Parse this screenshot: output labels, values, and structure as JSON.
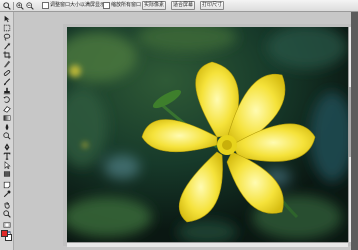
{
  "options_bar": {
    "resize_window_checkbox": {
      "label": "调整窗口大小以满屏显示",
      "checked": false
    },
    "zoom_all_windows_checkbox": {
      "label": "缩放所有窗口",
      "checked": false
    },
    "buttons": [
      "实际像素",
      "适合屏幕",
      "打印尺寸"
    ]
  },
  "toolbox": {
    "tools": [
      "move-icon",
      "marquee-icon",
      "lasso-icon",
      "magic-wand-icon",
      "crop-icon",
      "slice-icon",
      "healing-brush-icon",
      "brush-icon",
      "clone-stamp-icon",
      "history-brush-icon",
      "eraser-icon",
      "gradient-icon",
      "blur-icon",
      "dodge-icon",
      "pen-icon",
      "type-icon",
      "path-select-icon",
      "shape-icon",
      "notes-icon",
      "eyedropper-icon",
      "hand-icon",
      "zoom-icon"
    ],
    "foreground_color": "#e02828",
    "background_color": "#ffffff"
  },
  "canvas": {
    "image_subject": "yellow-flower-photo"
  }
}
